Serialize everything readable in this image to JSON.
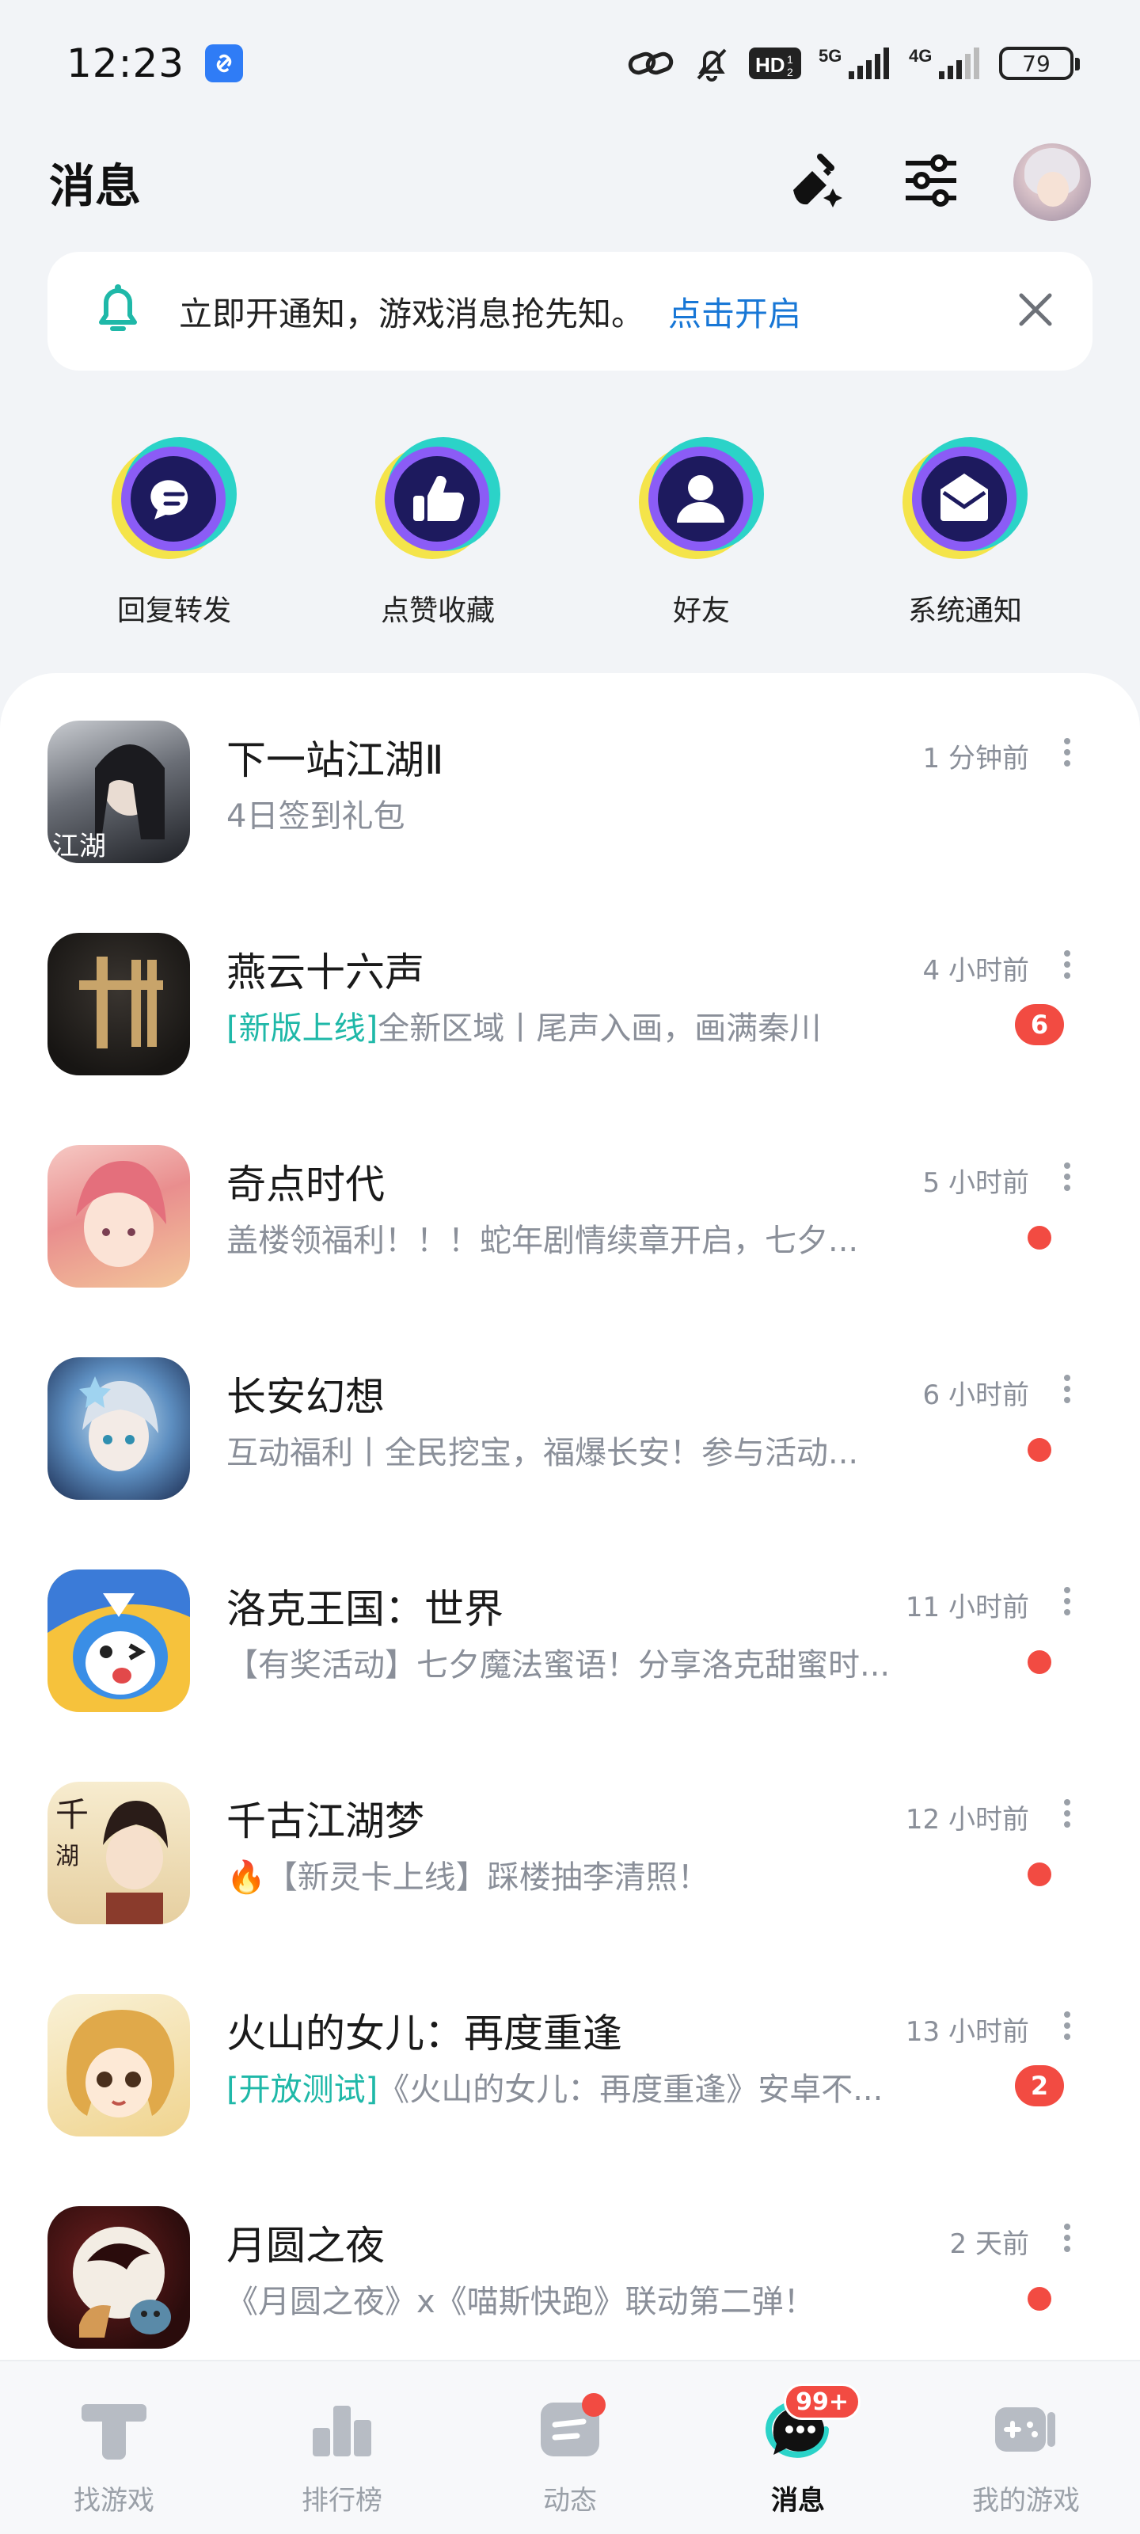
{
  "status_bar": {
    "time": "12:23",
    "battery": "79",
    "network_1": "5G",
    "network_2": "4G",
    "hd_label": "HD"
  },
  "header": {
    "title": "消息"
  },
  "notice": {
    "text": "立即开通知，游戏消息抢先知。",
    "link": "点击开启"
  },
  "quick_entries": [
    {
      "label": "回复转发",
      "icon": "chat-bubble-icon"
    },
    {
      "label": "点赞收藏",
      "icon": "thumbs-up-icon"
    },
    {
      "label": "好友",
      "icon": "person-icon"
    },
    {
      "label": "系统通知",
      "icon": "envelope-icon"
    }
  ],
  "messages": [
    {
      "title": "下一站江湖Ⅱ",
      "time": "1 分钟前",
      "tag": "",
      "text": "4日签到礼包",
      "badge": ""
    },
    {
      "title": "燕云十六声",
      "time": "4 小时前",
      "tag": "[新版上线]",
      "text": "全新区域丨尾声入画，画满秦川",
      "badge": "6"
    },
    {
      "title": "奇点时代",
      "time": "5 小时前",
      "tag": "",
      "text": "盖楼领福利！！！蛇年剧情续章开启，七夕...",
      "badge": "dot"
    },
    {
      "title": "长安幻想",
      "time": "6 小时前",
      "tag": "",
      "text": "互动福利丨全民挖宝，福爆长安！参与活动...",
      "badge": "dot"
    },
    {
      "title": "洛克王国：世界",
      "time": "11 小时前",
      "tag": "",
      "text": "【有奖活动】七夕魔法蜜语！分享洛克甜蜜时...",
      "badge": "dot"
    },
    {
      "title": "千古江湖梦",
      "time": "12 小时前",
      "tag": "",
      "text": "🔥【新灵卡上线】踩楼抽李清照！",
      "badge": "dot"
    },
    {
      "title": "火山的女儿：再度重逢",
      "time": "13 小时前",
      "tag": "[开放测试]",
      "text": "《火山的女儿：再度重逢》安卓不...",
      "badge": "2"
    },
    {
      "title": "月圆之夜",
      "time": "2 天前",
      "tag": "",
      "text": "《月圆之夜》x《喵斯快跑》联动第二弹！",
      "badge": "dot"
    }
  ],
  "bottom_nav": [
    {
      "label": "找游戏",
      "icon": "find-game-icon",
      "active": false
    },
    {
      "label": "排行榜",
      "icon": "ranking-icon",
      "active": false
    },
    {
      "label": "动态",
      "icon": "feed-icon",
      "active": false,
      "dot": true
    },
    {
      "label": "消息",
      "icon": "message-icon",
      "active": true,
      "badge": "99+"
    },
    {
      "label": "我的游戏",
      "icon": "my-games-icon",
      "active": false
    }
  ],
  "colors": {
    "accent_teal": "#1fb8a8",
    "link_blue": "#1877d6",
    "badge_red": "#f24b42",
    "quick_icon_navy": "#1d1a5e"
  }
}
